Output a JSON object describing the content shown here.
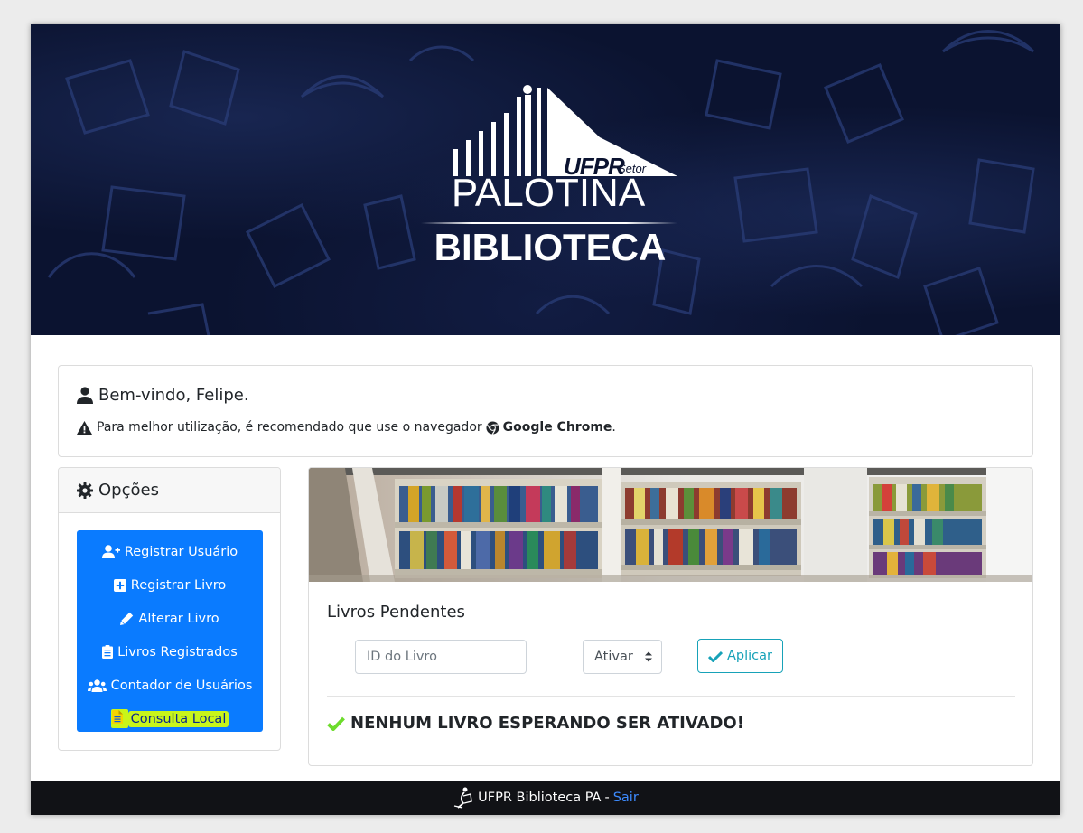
{
  "header": {
    "logo_ufpr": "UFPR",
    "logo_setor": "Setor",
    "logo_palotina": "PALOTINA",
    "logo_biblioteca": "BIBLIOTECA"
  },
  "welcome": {
    "title": "Bem-vindo, Felipe.",
    "note_prefix": "Para melhor utilização, é recomendado que use o navegador",
    "browser_name": "Google Chrome",
    "note_suffix": "."
  },
  "options": {
    "title": "Opções",
    "items": [
      {
        "label": "Registrar Usuário",
        "icon": "user-plus-icon"
      },
      {
        "label": "Registrar Livro",
        "icon": "plus-square-icon"
      },
      {
        "label": "Alterar Livro",
        "icon": "pencil-icon"
      },
      {
        "label": "Livros Registrados",
        "icon": "clipboard-list-icon"
      },
      {
        "label": "Contador de Usuários",
        "icon": "users-icon"
      },
      {
        "label": "Consulta Local",
        "icon": "file-icon",
        "highlighted": true
      }
    ]
  },
  "pending": {
    "title": "Livros Pendentes",
    "id_placeholder": "ID do Livro",
    "select_value": "Ativar",
    "apply_label": "Aplicar",
    "status_message": "NENHUM LIVRO ESPERANDO SER ATIVADO!"
  },
  "footer": {
    "site_name": "UFPR Biblioteca PA",
    "separator": "-",
    "logout_label": "Sair"
  },
  "colors": {
    "primary": "#0a7bff",
    "info": "#17a2b8",
    "success": "#6ddc2c",
    "highlight": "#c8f51a",
    "banner": "#0b1330",
    "footer": "#111216"
  }
}
